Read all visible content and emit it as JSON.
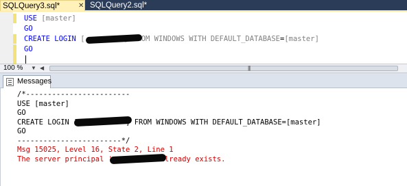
{
  "tabs": {
    "active": "SQLQuery3.sql*",
    "active_close": "✕",
    "inactive": "SQLQuery2.sql*"
  },
  "editor": {
    "lines": [
      {
        "kw": "USE",
        "rest": "[master]"
      },
      {
        "kw": "GO"
      },
      {
        "kw": "CREATE LOGIN",
        "rest": "[",
        "redacted": true,
        "tail1": "] FROM WINDOWS WITH DEFAULT_DATABASE",
        "tail2": "=",
        "tail3": "[master]"
      },
      {
        "kw": "GO"
      }
    ]
  },
  "statusbar": {
    "zoom": "100 %",
    "grip": "|||"
  },
  "results": {
    "tab_label": "Messages",
    "icon": "messages-icon",
    "lines": [
      "/*------------------------",
      "USE [master]",
      "GO",
      "CREATE LOGIN [",
      "] FROM WINDOWS WITH DEFAULT_DATABASE=[master]",
      "GO",
      "------------------------*/"
    ],
    "error1": "Msg 15025, Level 16, State 2, Line 1",
    "error2a": "The server principal '",
    "error2b": "' already exists."
  },
  "colors": {
    "tab_strip": "#2b3c59",
    "active_tab": "#fff1b8",
    "keyword": "#0000ff",
    "error": "#d00000"
  }
}
